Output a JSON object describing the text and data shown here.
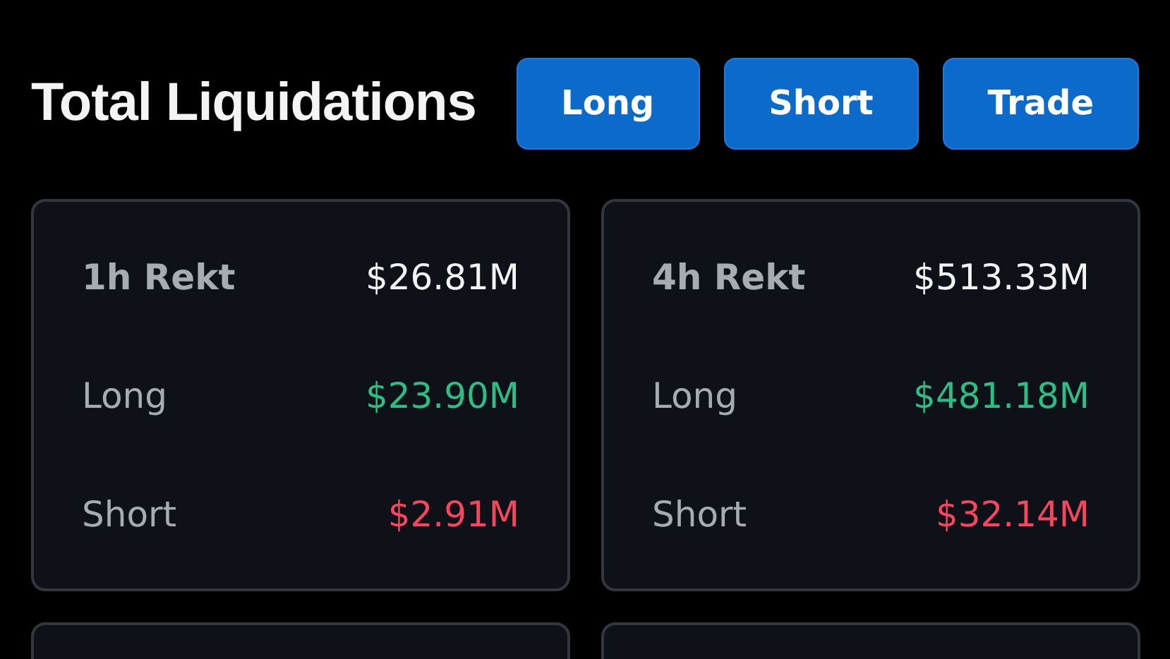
{
  "header": {
    "title": "Total Liquidations",
    "buttons": [
      "Long",
      "Short",
      "Trade"
    ]
  },
  "cards": [
    {
      "rows": [
        {
          "kind": "total",
          "label": "1h Rekt",
          "value": "$26.81M"
        },
        {
          "kind": "long",
          "label": "Long",
          "value": "$23.90M"
        },
        {
          "kind": "short",
          "label": "Short",
          "value": "$2.91M"
        }
      ]
    },
    {
      "rows": [
        {
          "kind": "total",
          "label": "4h Rekt",
          "value": "$513.33M"
        },
        {
          "kind": "long",
          "label": "Long",
          "value": "$481.18M"
        },
        {
          "kind": "short",
          "label": "Short",
          "value": "$32.14M"
        }
      ]
    }
  ]
}
